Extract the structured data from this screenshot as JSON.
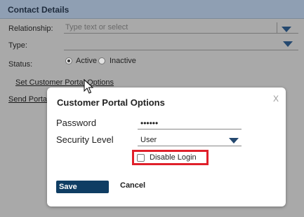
{
  "header": {
    "title": "Contact Details"
  },
  "form": {
    "relationship": {
      "label": "Relationship:",
      "placeholder": "Type text or select",
      "value": ""
    },
    "type": {
      "label": "Type:",
      "value": ""
    },
    "status": {
      "label": "Status:",
      "options": [
        "Active",
        "Inactive"
      ],
      "selected": "Active"
    },
    "links": {
      "set_portal_options": "Set Customer Portal Options",
      "send_portal": "Send Porta"
    }
  },
  "dialog": {
    "title": "Customer Portal Options",
    "close_label": "X",
    "password": {
      "label": "Password",
      "value": "••••••"
    },
    "security_level": {
      "label": "Security Level",
      "value": "User"
    },
    "disable_login": {
      "label": "Disable Login",
      "checked": false
    },
    "save_label": "Save",
    "cancel_label": "Cancel"
  },
  "colors": {
    "header_bg": "#8f9fb3",
    "overlay_bg": "#a9a9a9",
    "primary_button": "#0f3d63",
    "highlight_border": "#e0202a",
    "dropdown_caret": "#24486f"
  }
}
